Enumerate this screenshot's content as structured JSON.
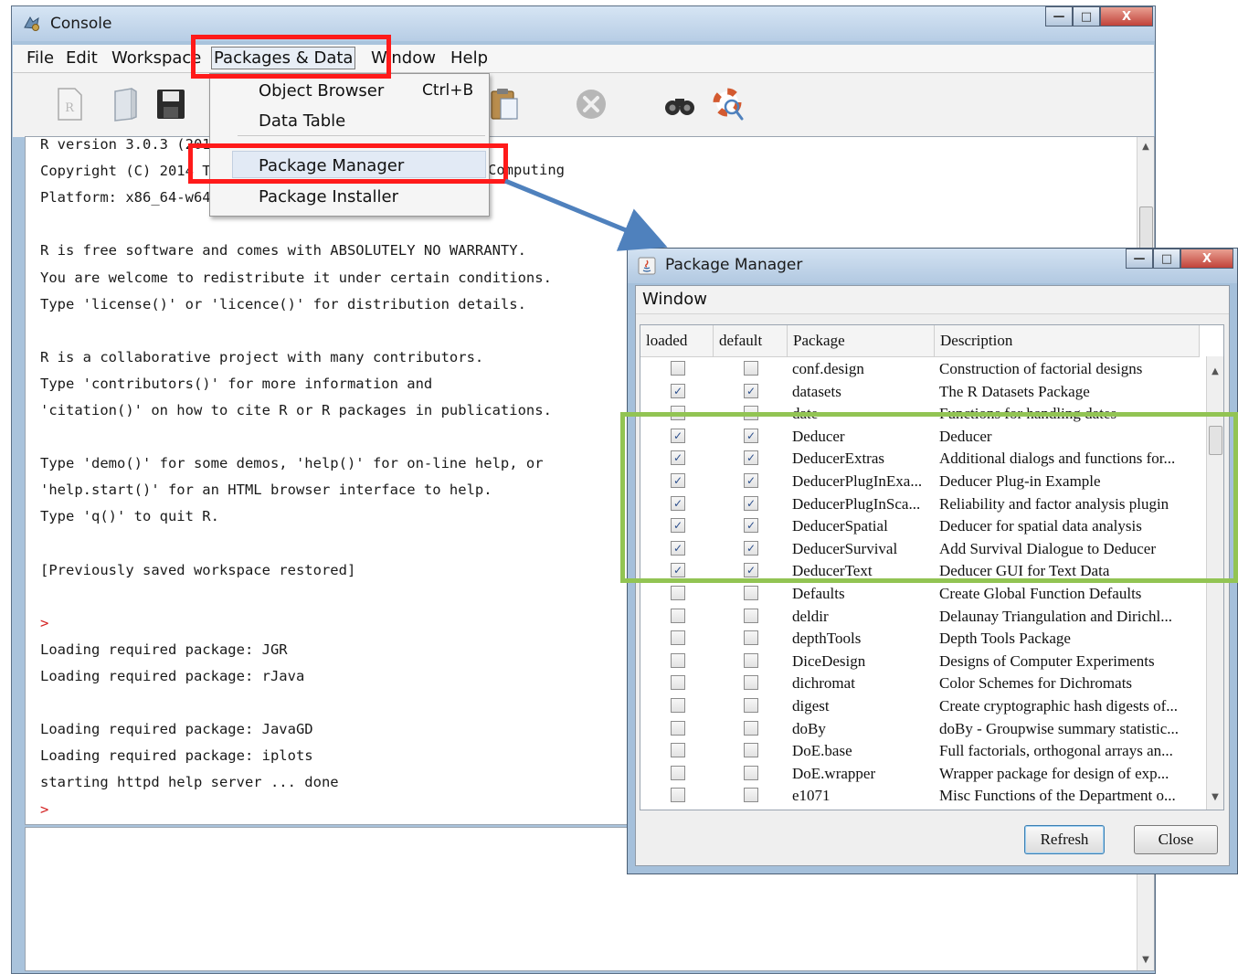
{
  "console": {
    "title": "Console",
    "menu": [
      "File",
      "Edit",
      "Workspace",
      "Packages & Data",
      "Window",
      "Help"
    ],
    "output_lines": [
      {
        "text": "R version 3.0.3 (2014",
        "prompt": false
      },
      {
        "text": "Copyright (C) 2014 Th",
        "prompt": false
      },
      {
        "text": "Platform: x86_64-w64-",
        "prompt": false
      },
      {
        "text": "",
        "prompt": false
      },
      {
        "text": "R is free software and comes with ABSOLUTELY NO WARRANTY.",
        "prompt": false
      },
      {
        "text": "You are welcome to redistribute it under certain conditions.",
        "prompt": false
      },
      {
        "text": "Type 'license()' or 'licence()' for distribution details.",
        "prompt": false
      },
      {
        "text": "",
        "prompt": false
      },
      {
        "text": "R is a collaborative project with many contributors.",
        "prompt": false
      },
      {
        "text": "Type 'contributors()' for more information and",
        "prompt": false
      },
      {
        "text": "'citation()' on how to cite R or R packages in publications.",
        "prompt": false
      },
      {
        "text": "",
        "prompt": false
      },
      {
        "text": "Type 'demo()' for some demos, 'help()' for on-line help, or",
        "prompt": false
      },
      {
        "text": "'help.start()' for an HTML browser interface to help.",
        "prompt": false
      },
      {
        "text": "Type 'q()' to quit R.",
        "prompt": false
      },
      {
        "text": "",
        "prompt": false
      },
      {
        "text": "[Previously saved workspace restored]",
        "prompt": false
      },
      {
        "text": "",
        "prompt": false
      },
      {
        "text": ">",
        "prompt": true
      },
      {
        "text": "Loading required package: JGR",
        "prompt": false
      },
      {
        "text": "Loading required package: rJava",
        "prompt": false
      },
      {
        "text": "",
        "prompt": false
      },
      {
        "text": "Loading required package: JavaGD",
        "prompt": false
      },
      {
        "text": "Loading required package: iplots",
        "prompt": false
      },
      {
        "text": "starting httpd help server ... done",
        "prompt": false
      },
      {
        "text": ">",
        "prompt": true
      }
    ],
    "partial_fragment": "Computing"
  },
  "packages_menu": {
    "items": [
      {
        "label": "Object Browser",
        "shortcut": "Ctrl+B"
      },
      {
        "label": "Data Table",
        "shortcut": ""
      },
      {
        "label": "Package Manager",
        "shortcut": ""
      },
      {
        "label": "Package Installer",
        "shortcut": ""
      }
    ],
    "highlighted": "Package Manager"
  },
  "package_manager": {
    "title": "Package Manager",
    "menu": "Window",
    "columns": [
      "loaded",
      "default",
      "Package",
      "Description"
    ],
    "rows": [
      {
        "loaded": false,
        "default": false,
        "package": "conf.design",
        "description": "Construction of factorial designs"
      },
      {
        "loaded": true,
        "default": true,
        "package": "datasets",
        "description": "The R Datasets Package"
      },
      {
        "loaded": false,
        "default": false,
        "package": "date",
        "description": "Functions for handling dates"
      },
      {
        "loaded": true,
        "default": true,
        "package": "Deducer",
        "description": "Deducer"
      },
      {
        "loaded": true,
        "default": true,
        "package": "DeducerExtras",
        "description": "Additional dialogs and functions for..."
      },
      {
        "loaded": true,
        "default": true,
        "package": "DeducerPlugInExa...",
        "description": "Deducer Plug-in Example"
      },
      {
        "loaded": true,
        "default": true,
        "package": "DeducerPlugInSca...",
        "description": "Reliability and factor analysis plugin"
      },
      {
        "loaded": true,
        "default": true,
        "package": "DeducerSpatial",
        "description": "Deducer for spatial data analysis"
      },
      {
        "loaded": true,
        "default": true,
        "package": "DeducerSurvival",
        "description": "Add Survival Dialogue to Deducer"
      },
      {
        "loaded": true,
        "default": true,
        "package": "DeducerText",
        "description": "Deducer GUI for Text Data"
      },
      {
        "loaded": false,
        "default": false,
        "package": "Defaults",
        "description": "Create Global Function Defaults"
      },
      {
        "loaded": false,
        "default": false,
        "package": "deldir",
        "description": "Delaunay Triangulation and Dirichl..."
      },
      {
        "loaded": false,
        "default": false,
        "package": "depthTools",
        "description": "Depth Tools Package"
      },
      {
        "loaded": false,
        "default": false,
        "package": "DiceDesign",
        "description": "Designs of Computer Experiments"
      },
      {
        "loaded": false,
        "default": false,
        "package": "dichromat",
        "description": "Color Schemes for Dichromats"
      },
      {
        "loaded": false,
        "default": false,
        "package": "digest",
        "description": "Create cryptographic hash digests of..."
      },
      {
        "loaded": false,
        "default": false,
        "package": "doBy",
        "description": "doBy - Groupwise summary statistic..."
      },
      {
        "loaded": false,
        "default": false,
        "package": "DoE.base",
        "description": "Full factorials, orthogonal arrays an..."
      },
      {
        "loaded": false,
        "default": false,
        "package": "DoE.wrapper",
        "description": "Wrapper package for design of exp..."
      },
      {
        "loaded": false,
        "default": false,
        "package": "e1071",
        "description": "Misc Functions of the Department o..."
      }
    ],
    "buttons": {
      "refresh": "Refresh",
      "close": "Close"
    }
  },
  "window_controls": {
    "minimize": "—",
    "maximize": "□",
    "close": "X"
  },
  "check_mark": "✓",
  "colors": {
    "annotation_red": "#ff1a1a",
    "annotation_green": "#92c453",
    "arrow_blue": "#4f81bd",
    "prompt_red": "#d42020"
  }
}
